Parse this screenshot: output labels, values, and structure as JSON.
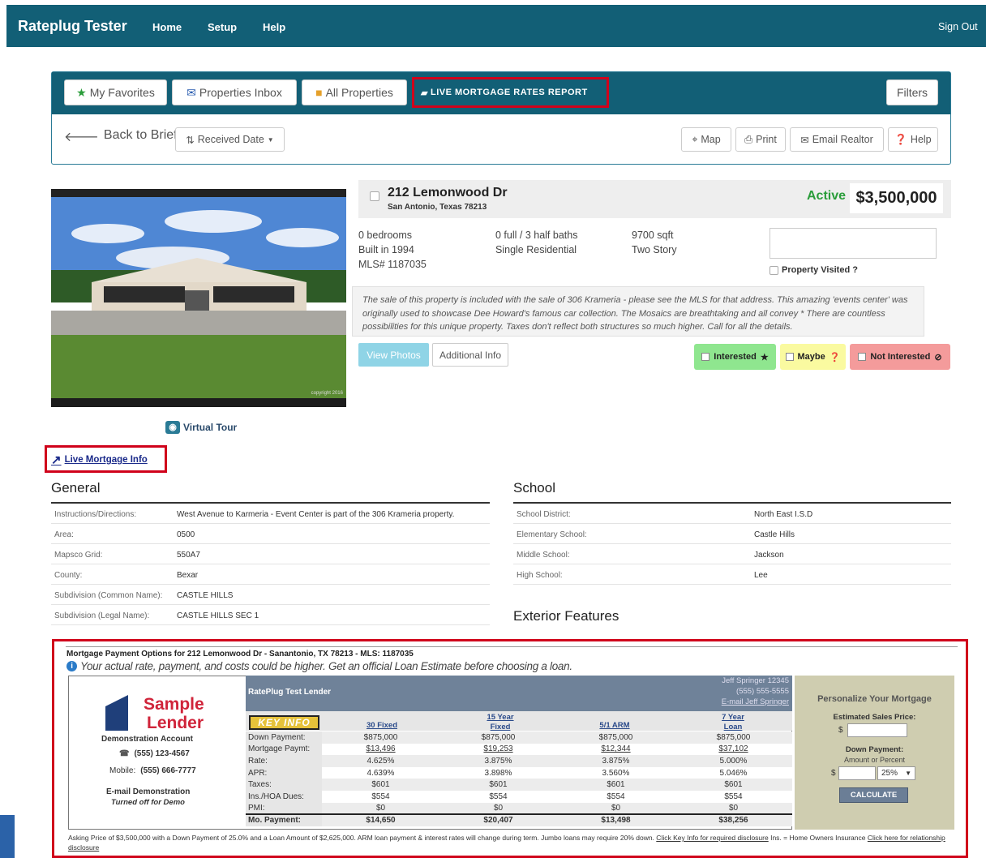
{
  "navbar": {
    "brand": "Rateplug Tester",
    "links": [
      "Home",
      "Setup",
      "Help"
    ],
    "signout": "Sign Out"
  },
  "tabs": {
    "favorites": "My Favorites",
    "inbox": "Properties Inbox",
    "all": "All Properties",
    "live": "LIVE MORTGAGE RATES REPORT",
    "filters": "Filters"
  },
  "subbar": {
    "back": "Back to Brief",
    "sort": "Received Date",
    "map": "Map",
    "print": "Print",
    "email": "Email Realtor",
    "help": "Help"
  },
  "listing": {
    "address": "212 Lemonwood Dr",
    "city": "San Antonio, Texas 78213",
    "status": "Active",
    "price": "$3,500,000",
    "bedrooms": "0 bedrooms",
    "built": "Built in 1994",
    "mls": "MLS# 1187035",
    "baths": "0 full / 3 half baths",
    "type": "Single Residential",
    "sqft": "9700 sqft",
    "story": "Two Story",
    "visited": "Property Visited ?",
    "description": "The sale of this property is included with the sale of 306 Krameria - please see the MLS for that address. This amazing 'events center' was originally used to showcase Dee Howard's famous car collection. The Mosaics are breathtaking and all convey * There are countless possibilities for this unique property. Taxes don't reflect both structures so much higher. Call for all the details.",
    "view_photos": "View Photos",
    "additional": "Additional Info",
    "interested": "Interested",
    "maybe": "Maybe",
    "not_interested": "Not Interested",
    "virtual_tour": "Virtual Tour",
    "live_mortgage": "Live Mortgage Info",
    "photo_caption": "copyright 2016"
  },
  "general": {
    "title": "General",
    "rows": [
      {
        "k": "Instructions/Directions:",
        "v": "West Avenue to Karmeria - Event Center is part of the 306 Krameria property."
      },
      {
        "k": "Area:",
        "v": "0500"
      },
      {
        "k": "Mapsco Grid:",
        "v": "550A7"
      },
      {
        "k": "County:",
        "v": "Bexar"
      },
      {
        "k": "Subdivision (Common Name):",
        "v": "CASTLE HILLS"
      },
      {
        "k": "Subdivision (Legal Name):",
        "v": "CASTLE HILLS SEC 1"
      }
    ]
  },
  "school": {
    "title": "School",
    "rows": [
      {
        "k": "School District:",
        "v": "North East I.S.D"
      },
      {
        "k": "Elementary School:",
        "v": "Castle Hills"
      },
      {
        "k": "Middle School:",
        "v": "Jackson"
      },
      {
        "k": "High School:",
        "v": "Lee"
      }
    ]
  },
  "exterior_title": "Exterior Features",
  "mortgage": {
    "heading": "Mortgage Payment Options for 212 Lemonwood Dr - Sanantonio, TX 78213 - MLS: 1187035",
    "notice": "Your actual rate, payment, and costs could be higher. Get an official Loan Estimate before choosing a loan.",
    "lender_logo_1": "Sample",
    "lender_logo_2": "Lender",
    "account": "Demonstration Account",
    "phone": "(555) 123-4567",
    "mobile_label": "Mobile:",
    "mobile": "(555) 666-7777",
    "email_demo": "E-mail Demonstration",
    "turned_off": "Turned off for Demo",
    "lender_name": "RatePlug Test Lender",
    "agent_name": "Jeff Springer 12345",
    "agent_phone": "(555) 555-5555",
    "agent_email": "E-mail Jeff Springer",
    "key_info": "KEY INFO",
    "columns": [
      "30 Fixed",
      "15 Year Fixed",
      "5/1 ARM",
      "7 Year Loan"
    ],
    "rows": [
      {
        "label": "Down Payment:",
        "vals": [
          "$875,000",
          "$875,000",
          "$875,000",
          "$875,000"
        ]
      },
      {
        "label": "Mortgage Paymt:",
        "vals": [
          "$13,496",
          "$19,253",
          "$12,344",
          "$37,102"
        ]
      },
      {
        "label": "Rate:",
        "vals": [
          "4.625%",
          "3.875%",
          "3.875%",
          "5.000%"
        ]
      },
      {
        "label": "APR:",
        "vals": [
          "4.639%",
          "3.898%",
          "3.560%",
          "5.046%"
        ]
      },
      {
        "label": "Taxes:",
        "vals": [
          "$601",
          "$601",
          "$601",
          "$601"
        ]
      },
      {
        "label": "Ins./HOA Dues:",
        "vals": [
          "$554",
          "$554",
          "$554",
          "$554"
        ]
      },
      {
        "label": "PMI:",
        "vals": [
          "$0",
          "$0",
          "$0",
          "$0"
        ]
      },
      {
        "label": "Mo. Payment:",
        "vals": [
          "$14,650",
          "$20,407",
          "$13,498",
          "$38,256"
        ]
      }
    ],
    "personalize": "Personalize Your Mortgage",
    "est_price": "Estimated Sales Price:",
    "down_label": "Down Payment:",
    "amount_or": "Amount or Percent",
    "percent": "25%",
    "calculate": "CALCULATE",
    "footer1": "Asking Price of $3,500,000 with a Down Payment of 25.0% and a Loan Amount of $2,625,000. ARM loan payment & interest rates will change during term. Jumbo loans may require 20% down.",
    "footer_link": "Click Key Info for required disclosure",
    "footer2": "Ins. = Home Owners Insurance",
    "footer_link2": "Click here for relationship disclosure"
  }
}
